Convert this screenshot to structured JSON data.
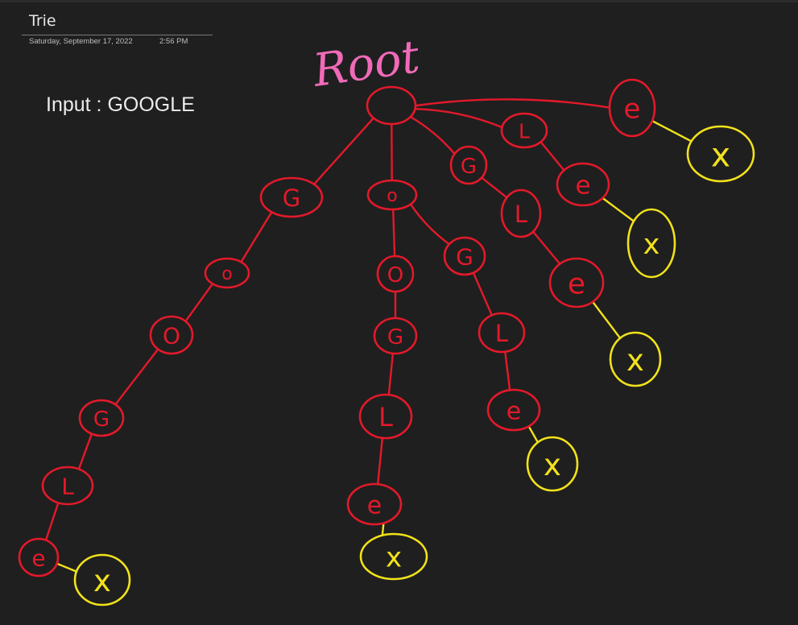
{
  "page": {
    "title": "Trie",
    "date": "Saturday, September 17, 2022",
    "time": "2:56 PM"
  },
  "note": {
    "input_text": "Input : GOOGLE"
  },
  "diagram": {
    "root_label": "Root",
    "colors": {
      "background": "#1f1f1f",
      "node_red": "#e3192a",
      "end_yellow": "#f2e21b",
      "root_pink": "#f06ab8"
    },
    "nodes": [
      {
        "id": "root",
        "label": ""
      },
      {
        "id": "b1_g",
        "label": "G"
      },
      {
        "id": "b1_o1",
        "label": "o"
      },
      {
        "id": "b1_o2",
        "label": "O"
      },
      {
        "id": "b1_g2",
        "label": "G"
      },
      {
        "id": "b1_l",
        "label": "L"
      },
      {
        "id": "b1_e",
        "label": "e"
      },
      {
        "id": "b1_x",
        "label": "x",
        "end": true
      },
      {
        "id": "b2_o",
        "label": "o"
      },
      {
        "id": "b2_o2",
        "label": "O"
      },
      {
        "id": "b2_g",
        "label": "G"
      },
      {
        "id": "b2_l",
        "label": "L"
      },
      {
        "id": "b2_e",
        "label": "e"
      },
      {
        "id": "b2_x",
        "label": "x",
        "end": true
      },
      {
        "id": "b3_g",
        "label": "G"
      },
      {
        "id": "b3_l",
        "label": "L"
      },
      {
        "id": "b3_e",
        "label": "e"
      },
      {
        "id": "b3_x",
        "label": "x",
        "end": true
      },
      {
        "id": "b4_g",
        "label": "G"
      },
      {
        "id": "b4_l",
        "label": "L"
      },
      {
        "id": "b4_e",
        "label": "e"
      },
      {
        "id": "b4_x",
        "label": "x",
        "end": true
      },
      {
        "id": "b5_l",
        "label": "L"
      },
      {
        "id": "b5_e",
        "label": "e"
      },
      {
        "id": "b5_x",
        "label": "x",
        "end": true
      },
      {
        "id": "b6_e",
        "label": "e"
      },
      {
        "id": "b6_x",
        "label": "x",
        "end": true
      }
    ],
    "edges": [
      [
        "root",
        "b1_g"
      ],
      [
        "b1_g",
        "b1_o1"
      ],
      [
        "b1_o1",
        "b1_o2"
      ],
      [
        "b1_o2",
        "b1_g2"
      ],
      [
        "b1_g2",
        "b1_l"
      ],
      [
        "b1_l",
        "b1_e"
      ],
      [
        "b1_e",
        "b1_x"
      ],
      [
        "root",
        "b2_o"
      ],
      [
        "b2_o",
        "b2_o2"
      ],
      [
        "b2_o2",
        "b2_g"
      ],
      [
        "b2_g",
        "b2_l"
      ],
      [
        "b2_l",
        "b2_e"
      ],
      [
        "b2_e",
        "b2_x"
      ],
      [
        "b2_o",
        "b3_g"
      ],
      [
        "b3_g",
        "b3_l"
      ],
      [
        "b3_l",
        "b3_e"
      ],
      [
        "b3_e",
        "b3_x"
      ],
      [
        "root",
        "b4_g"
      ],
      [
        "b4_g",
        "b4_l"
      ],
      [
        "b4_l",
        "b4_e"
      ],
      [
        "b4_e",
        "b4_x"
      ],
      [
        "root",
        "b5_l"
      ],
      [
        "b5_l",
        "b5_e"
      ],
      [
        "b5_e",
        "b5_x"
      ],
      [
        "root",
        "b6_e"
      ],
      [
        "b6_e",
        "b6_x"
      ]
    ]
  }
}
